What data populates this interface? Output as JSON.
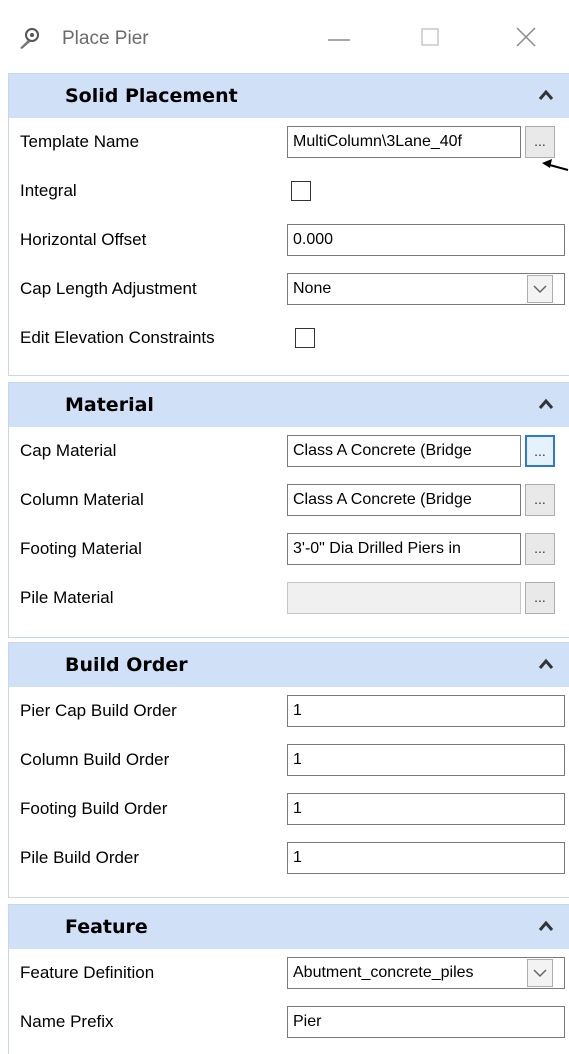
{
  "window": {
    "title": "Place Pier",
    "icon": "gear-pencil-icon"
  },
  "sections": {
    "solid_placement": {
      "title": "Solid Placement",
      "template_name": {
        "label": "Template Name",
        "value": "MultiColumn\\3Lane_40f",
        "button": "..."
      },
      "integral": {
        "label": "Integral",
        "checked": false
      },
      "horizontal_offset": {
        "label": "Horizontal Offset",
        "value": "0.000"
      },
      "cap_length_adjustment": {
        "label": "Cap Length Adjustment",
        "value": "None"
      },
      "edit_elevation_constraints": {
        "label": "Edit Elevation Constraints",
        "checked": false
      }
    },
    "material": {
      "title": "Material",
      "cap_material": {
        "label": "Cap Material",
        "value": "Class A Concrete (Bridge",
        "button": "..."
      },
      "column_material": {
        "label": "Column Material",
        "value": "Class A Concrete (Bridge",
        "button": "..."
      },
      "footing_material": {
        "label": "Footing Material",
        "value": "3'-0\" Dia Drilled Piers in",
        "button": "..."
      },
      "pile_material": {
        "label": "Pile Material",
        "value": "",
        "button": "..."
      }
    },
    "build_order": {
      "title": "Build Order",
      "pier_cap": {
        "label": "Pier Cap Build Order",
        "value": "1"
      },
      "column": {
        "label": "Column Build Order",
        "value": "1"
      },
      "footing": {
        "label": "Footing Build Order",
        "value": "1"
      },
      "pile": {
        "label": "Pile Build Order",
        "value": "1"
      }
    },
    "feature": {
      "title": "Feature",
      "feature_definition": {
        "label": "Feature Definition",
        "value": "Abutment_concrete_piles"
      },
      "name_prefix": {
        "label": "Name Prefix",
        "value": "Pier"
      }
    }
  },
  "colors": {
    "section_header": "#cfe0f7",
    "focus_border": "#2b79d6"
  }
}
